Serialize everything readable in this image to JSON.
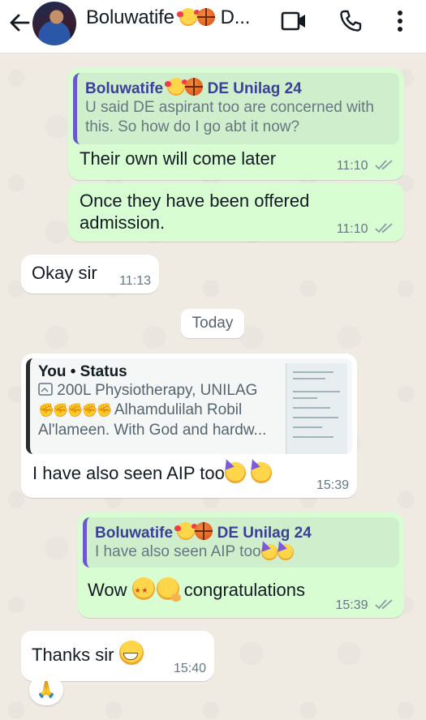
{
  "header": {
    "title": "Boluwatife",
    "title_suffix": "D...",
    "icons": [
      "back-arrow-icon",
      "avatar",
      "video-call-icon",
      "voice-call-icon",
      "more-options-icon"
    ]
  },
  "messages": [
    {
      "direction": "outgoing",
      "quote_author": "Boluwatife",
      "quote_author_suffix": "DE Unilag 24",
      "quote_text": "U said DE aspirant too are concerned with this.  So how do I go abt it now?",
      "text": "Their own will come later",
      "time": "11:10"
    },
    {
      "direction": "outgoing",
      "text": "Once they have been offered admission.",
      "time": "11:10"
    },
    {
      "direction": "incoming",
      "text": "Okay sir",
      "time": "11:13"
    },
    {
      "direction": "incoming",
      "quote_author": "You • Status",
      "quote_line1": "200L Physiotherapy, UNILAG",
      "quote_line2": "Alhamdulilah Robil",
      "quote_line3": "Al'lameen. With God and hardw...",
      "text": "I have also seen AIP too",
      "time": "15:39"
    },
    {
      "direction": "outgoing",
      "quote_author": "Boluwatife",
      "quote_author_suffix": "DE Unilag 24",
      "quote_text": "I have also seen AIP too",
      "text_before": "Wow",
      "text_after": "congratulations",
      "time": "15:39"
    },
    {
      "direction": "incoming",
      "text": "Thanks sir",
      "time": "15:40",
      "reaction": "🙏"
    }
  ],
  "day_divider": "Today",
  "colors": {
    "outgoing_bubble": "#d9fdd3",
    "incoming_bubble": "#ffffff",
    "chat_background": "#efeae2",
    "read_ticks": "#8a9aa4"
  }
}
